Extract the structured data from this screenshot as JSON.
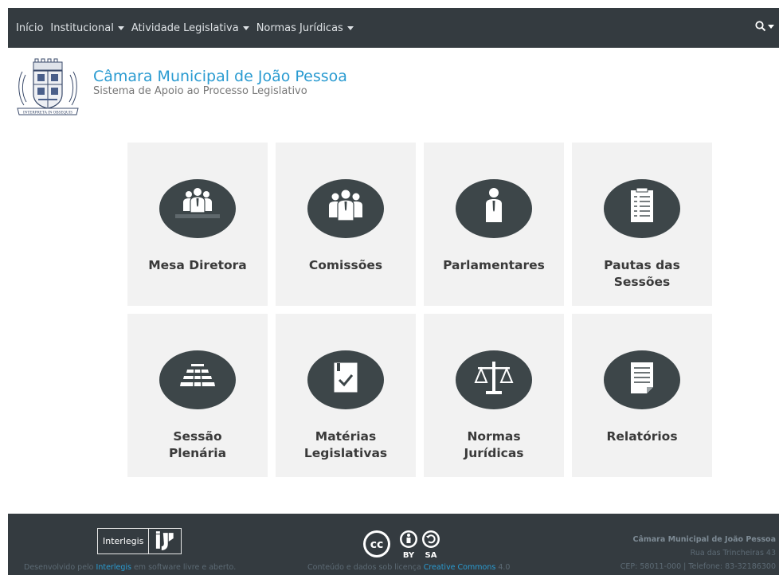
{
  "nav": {
    "items": [
      {
        "label": "Início",
        "dropdown": false
      },
      {
        "label": "Institucional",
        "dropdown": true
      },
      {
        "label": "Atividade Legislativa",
        "dropdown": true
      },
      {
        "label": "Normas Jurídicas",
        "dropdown": true
      }
    ],
    "search_icon": "search-icon"
  },
  "header": {
    "title": "Câmara Municipal de João Pessoa",
    "subtitle": "Sistema de Apoio ao Processo Legislativo",
    "logo_text": "INTERPRETA IN OBSEQUIS"
  },
  "tiles": [
    {
      "label": "Mesa Diretora",
      "icon": "mesa-diretora-icon"
    },
    {
      "label": "Comissões",
      "icon": "comissoes-icon"
    },
    {
      "label": "Parlamentares",
      "icon": "parlamentares-icon"
    },
    {
      "label": "Pautas das Sessões",
      "icon": "pautas-icon"
    },
    {
      "label": "Sessão Plenária",
      "icon": "sessao-plenaria-icon"
    },
    {
      "label": "Matérias Legislativas",
      "icon": "materias-icon"
    },
    {
      "label": "Normas Jurídicas",
      "icon": "normas-icon"
    },
    {
      "label": "Relatórios",
      "icon": "relatorios-icon"
    }
  ],
  "footer": {
    "interlegis_label": "Interlegis",
    "dev_prefix": "Desenvolvido pelo ",
    "dev_link": "Interlegis",
    "dev_suffix": " em software livre e aberto.",
    "license_prefix": "Conteúdo e dados sob licença ",
    "license_link": "Creative Commons",
    "license_suffix": " 4.0",
    "cc_by": "BY",
    "cc_sa": "SA",
    "org_name": "Câmara Municipal de João Pessoa",
    "address": "Rua das Trincheiras 43",
    "contact": "CEP: 58011-000 | Telefone: 83-32186300"
  },
  "colors": {
    "navbar": "#343b40",
    "accent": "#2a9bd1",
    "tile_bg": "#f2f2f2",
    "icon_circle": "#3d4649"
  }
}
